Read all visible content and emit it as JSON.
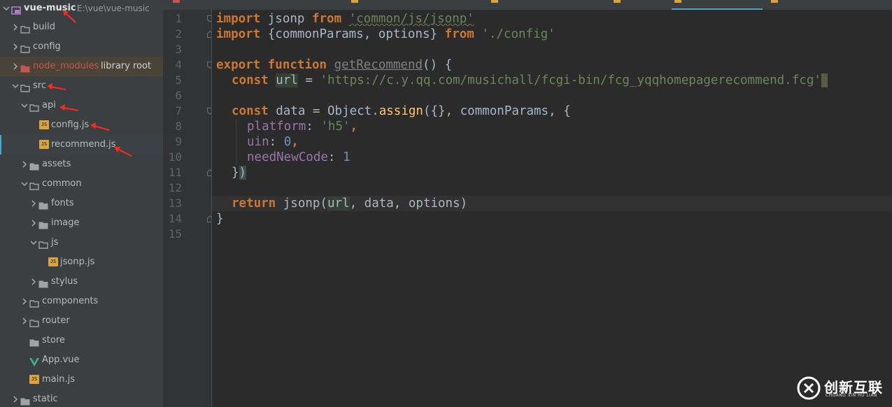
{
  "project": {
    "name": "vue-music",
    "path": "E:\\vue\\vue-music"
  },
  "tree": {
    "build": "build",
    "config": "config",
    "node_modules": "node_modules",
    "node_modules_hint": "library root",
    "src": "src",
    "api": "api",
    "config_js": "config.js",
    "recommend_js": "recommend.js",
    "assets": "assets",
    "common": "common",
    "fonts": "fonts",
    "image": "image",
    "js": "js",
    "jsonp_js": "jsonp.js",
    "stylus": "stylus",
    "components": "components",
    "router": "router",
    "store": "store",
    "app_vue": "App.vue",
    "main_js": "main.js",
    "static": "static",
    "file_badge": "JS"
  },
  "editor": {
    "line_numbers": [
      "1",
      "2",
      "3",
      "4",
      "5",
      "6",
      "7",
      "8",
      "9",
      "10",
      "11",
      "12",
      "13",
      "14",
      "15"
    ],
    "current_line": 13,
    "l1": {
      "k1": "import",
      "t1": " jsonp ",
      "k2": "from",
      "t2": " ",
      "s1": "'common/js/jsonp'"
    },
    "l2": {
      "k1": "import",
      "t1": " {commonParams, options} ",
      "k2": "from",
      "t2": " ",
      "s1": "'./config'"
    },
    "l4": {
      "k1": "export",
      "t1": " ",
      "k2": "function",
      "t2": " ",
      "f1": "getRecommend",
      "t3": "() {"
    },
    "l5": {
      "k1": "const",
      "t1": " ",
      "v1": "url",
      "t2": " = ",
      "s1": "'https://c.y.qq.com/musichall/fcgi-bin/fcg_yqqhomepagerecommend.fcg'"
    },
    "l7": {
      "k1": "const",
      "t1": " data = Object.",
      "f1": "assign",
      "t2": "({}, commonParams, {"
    },
    "l8": {
      "p1": "platform",
      "t1": ": ",
      "s1": "'h5'",
      "t2": ","
    },
    "l9": {
      "p1": "uin",
      "t1": ": ",
      "n1": "0",
      "t2": ","
    },
    "l10": {
      "p1": "needNewCode",
      "t1": ": ",
      "n1": "1"
    },
    "l11": {
      "t1": "}",
      "t2": ")"
    },
    "l13": {
      "k1": "return",
      "t1": " jsonp(",
      "v1": "url",
      "t2": ", data, options)"
    },
    "l14": {
      "t1": "}"
    }
  },
  "watermark": {
    "title": "创新互联",
    "subtitle": "CHUANG XIN HU LIAN"
  },
  "colors": {
    "keyword": "#cc7832",
    "string": "#6a8759",
    "function": "#ffc66d",
    "property": "#9876aa",
    "number": "#6897bb",
    "text": "#a9b7c6",
    "annotation_arrow": "#ff2a1a"
  }
}
